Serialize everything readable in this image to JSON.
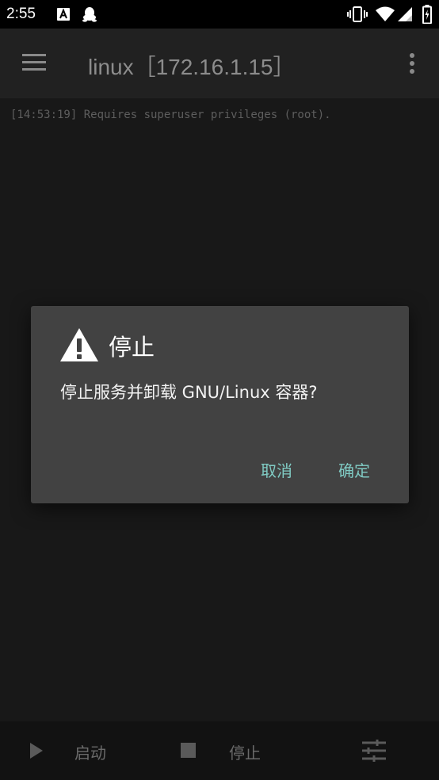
{
  "status_bar": {
    "time": "2:55",
    "icons": [
      "font-a-icon",
      "qq-penguin-icon",
      "vibrate-icon",
      "wifi-icon",
      "signal-icon",
      "battery-charging-icon"
    ]
  },
  "app_bar": {
    "title": "linux［172.16.1.15］",
    "icons": [
      "menu-icon",
      "overflow-menu-icon"
    ]
  },
  "log": {
    "lines": [
      "[14:53:19] Requires superuser privileges (root)."
    ]
  },
  "dialog": {
    "title": "停止",
    "icon": "warning-icon",
    "message": "停止服务并卸载 GNU/Linux 容器?",
    "cancel_label": "取消",
    "confirm_label": "确定",
    "accent_color": "#80cbc4"
  },
  "bottom_bar": {
    "start_label": "启动",
    "stop_label": "停止",
    "icons": [
      "play-icon",
      "stop-icon",
      "tune-icon"
    ]
  }
}
